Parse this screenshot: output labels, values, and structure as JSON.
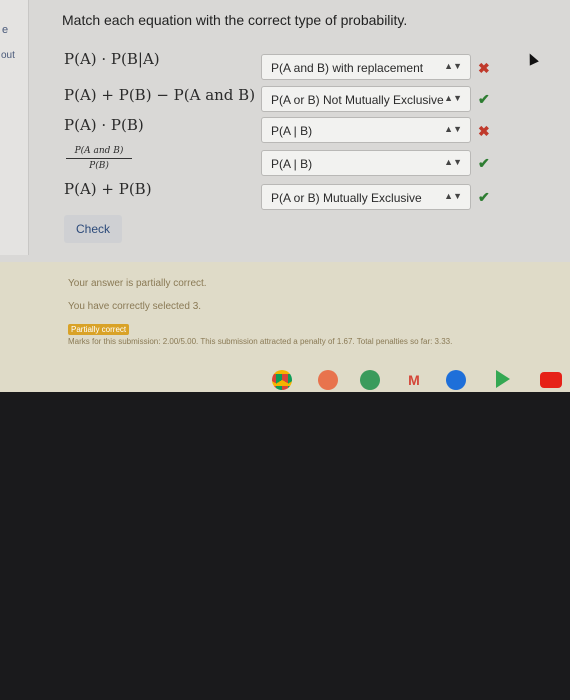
{
  "left_panel": {
    "label_top": "e",
    "label_bottom": "out"
  },
  "prompt": "Match each equation with the correct type of probability.",
  "equations": [
    "P(A) · P(B|A)",
    "P(A) + P(B) − P(A and B)",
    "P(A) · P(B)",
    {
      "numerator": "P(A and B)",
      "denominator": "P(B)"
    },
    "P(A) + P(B)"
  ],
  "selects": [
    {
      "value": "P(A and B) with replacement",
      "result": "✖"
    },
    {
      "value": "P(A or B) Not Mutually Exclusive",
      "result": "✔"
    },
    {
      "value": "P(A | B)",
      "result": "✖"
    },
    {
      "value": "P(A | B)",
      "result": "✔"
    },
    {
      "value": "P(A or B) Mutually Exclusive",
      "result": "✔"
    }
  ],
  "check_label": "Check",
  "feedback": {
    "line1": "Your answer is partially correct.",
    "line2": "You have correctly selected 3.",
    "badge": "Partially correct",
    "marks": "Marks for this submission: 2.00/5.00. This submission attracted a penalty of 1.67. Total penalties so far: 3.33."
  },
  "shelf_icons": [
    "chrome-icon",
    "photos-icon",
    "classroom-icon",
    "gmail-icon",
    "files-icon",
    "play-store-icon",
    "youtube-icon"
  ],
  "colors": {
    "wrong": "#c0392b",
    "right": "#2e7d32",
    "badge": "#d9a227"
  }
}
